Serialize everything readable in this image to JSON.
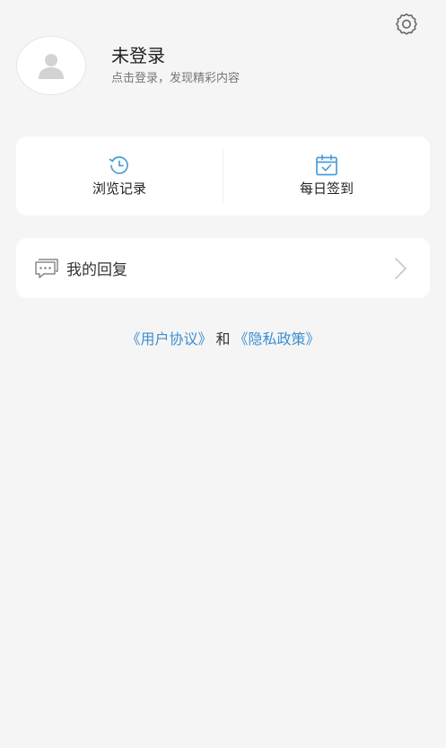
{
  "header": {
    "settings_icon": "gear-icon"
  },
  "profile": {
    "avatar_icon": "user-icon",
    "name": "未登录",
    "hint": "点击登录，发现精彩内容"
  },
  "quick_actions": [
    {
      "label": "浏览记录",
      "icon": "history-clock-icon"
    },
    {
      "label": "每日签到",
      "icon": "calendar-check-icon"
    }
  ],
  "menu": {
    "reply_label": "我的回复",
    "reply_icon": "chat-bubble-icon"
  },
  "agreement": {
    "user_agreement": "《用户协议》",
    "and": "和",
    "privacy_policy": "《隐私政策》"
  },
  "colors": {
    "background": "#f5f5f5",
    "card": "#ffffff",
    "accent_link": "#3d8fd0",
    "icon_blue": "#4a9fd8"
  }
}
